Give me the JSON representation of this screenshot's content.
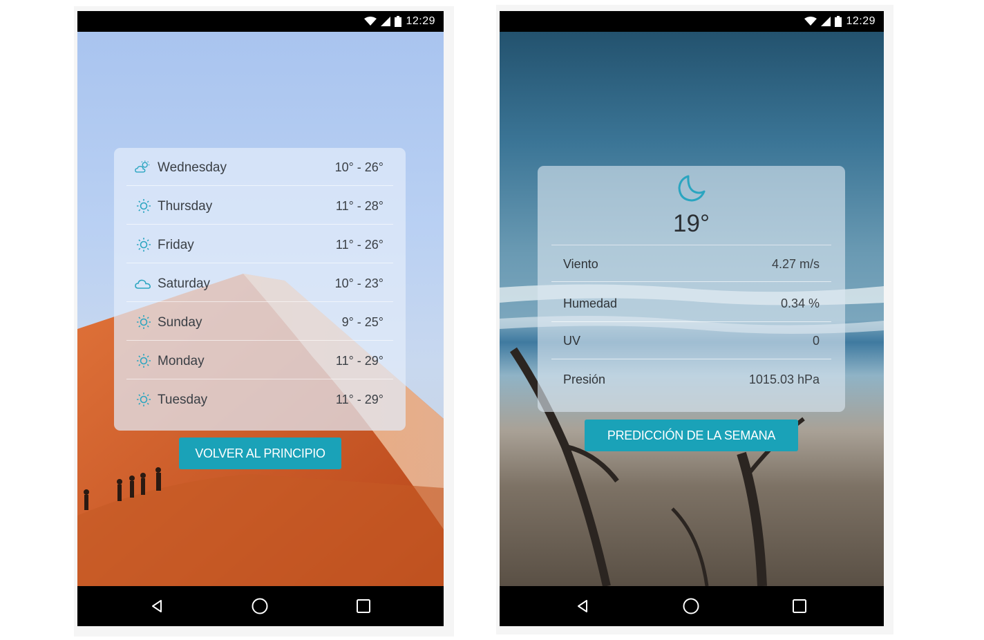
{
  "status_bar": {
    "time": "12:29"
  },
  "left_screen": {
    "forecast": [
      {
        "day": "Wednesday",
        "temp": "10° - 26°",
        "icon": "partly-cloudy-icon"
      },
      {
        "day": "Thursday",
        "temp": "11° - 28°",
        "icon": "sun-icon"
      },
      {
        "day": "Friday",
        "temp": "11° - 26°",
        "icon": "sun-icon"
      },
      {
        "day": "Saturday",
        "temp": "10° - 23°",
        "icon": "cloud-icon"
      },
      {
        "day": "Sunday",
        "temp": "9° - 25°",
        "icon": "sun-icon"
      },
      {
        "day": "Monday",
        "temp": "11° - 29°",
        "icon": "sun-icon"
      },
      {
        "day": "Tuesday",
        "temp": "11° - 29°",
        "icon": "sun-icon"
      }
    ],
    "back_button": "VOLVER AL PRINCIPIO"
  },
  "right_screen": {
    "current_icon": "moon-icon",
    "current_temp": "19°",
    "details": [
      {
        "label": "Viento",
        "value": "4.27 m/s"
      },
      {
        "label": "Humedad",
        "value": "0.34 %"
      },
      {
        "label": "UV",
        "value": "0"
      },
      {
        "label": "Presión",
        "value": "1015.03 hPa"
      }
    ],
    "week_button": "PREDICCIÓN DE LA SEMANA"
  },
  "colors": {
    "accent": "#1aa2b8",
    "icon_color": "#2aa5c0"
  }
}
